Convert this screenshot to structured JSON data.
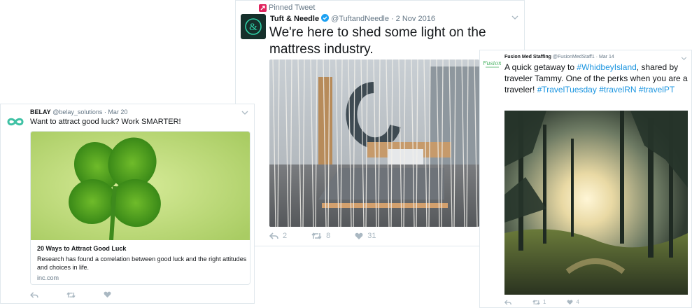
{
  "tweet_center": {
    "pinned_label": "Pinned Tweet",
    "name": "Tuft & Needle",
    "handle": "@TuftandNeedle",
    "separator": "·",
    "date": "2 Nov 2016",
    "text": "We're here to shed some light on the mattress industry.",
    "actions": {
      "reply": "2",
      "retweet": "8",
      "like": "31"
    }
  },
  "tweet_left": {
    "name": "BELAY",
    "handle": "@belay_solutions",
    "separator": "·",
    "date": "Mar 20",
    "text": "Want to attract good luck? Work SMARTER!",
    "card": {
      "title": "20 Ways to Attract Good Luck",
      "description": "Research has found a correlation between good luck and the right attitudes and choices in life.",
      "domain": "inc.com"
    }
  },
  "tweet_right": {
    "name": "Fusion Med Staffing",
    "handle": "@FusionMedStaff1",
    "separator": "·",
    "date": "Mar 14",
    "text_parts": [
      "A quick getaway to ",
      "#WhidbeyIsland",
      ", shared by traveler Tammy. One of the perks when you are a traveler! ",
      "#TravelTuesday",
      " ",
      "#travelRN",
      " ",
      "#travelPT"
    ],
    "actions": {
      "retweet": "1",
      "like": "4"
    }
  },
  "colors": {
    "link": "#1b95e0",
    "muted": "#657786",
    "border": "#e1e8ed",
    "icon": "#aab8c2",
    "verified": "#1da1f2",
    "pin": "#e0245e"
  }
}
